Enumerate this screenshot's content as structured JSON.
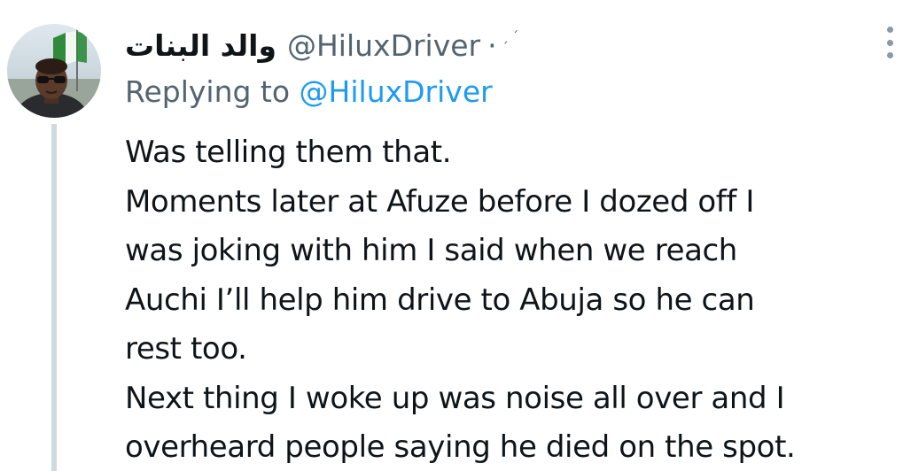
{
  "author": {
    "display_name": "والد البنات",
    "handle": "@HiluxDriver",
    "separator": "·",
    "time": "ˏ ˊ"
  },
  "reply_context": {
    "prefix": "Replying to",
    "mention": "@HiluxDriver"
  },
  "tweet": {
    "lines": [
      "Was telling them that.",
      "Moments later at Afuze before I dozed off I",
      "was joking with him I said when we reach",
      "Auchi I’ll help him drive to Abuja so he can",
      "rest too.",
      "Next thing I woke up was noise all over and I",
      "overheard people saying he died on the spot."
    ]
  },
  "icons": {
    "more": "more-vertical-icon",
    "avatar": "avatar-photo"
  },
  "colors": {
    "text": "#0f1419",
    "secondary": "#536471",
    "accent": "#1d9bf0",
    "thread_line": "#cfd9de"
  }
}
